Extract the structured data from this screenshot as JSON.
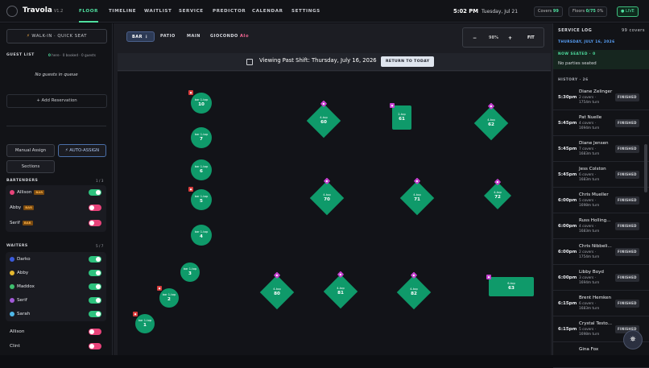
{
  "app": {
    "name": "Travola",
    "version": "V1.2"
  },
  "nav": [
    "FLOOR",
    "TIMELINE",
    "WAITLIST",
    "SERVICE",
    "PREDICTOR",
    "CALENDAR",
    "SETTINGS"
  ],
  "header": {
    "time": "5:02 PM",
    "date": "Tuesday, Jul 21",
    "covers_label": "Covers",
    "covers_value": "99",
    "floors_label": "Floors",
    "floors_value": "0/75",
    "floors_pct": "0%",
    "live": "LIVE"
  },
  "left": {
    "walkin": "WALK-IN · QUICK SEAT",
    "guest_list": "GUEST LIST",
    "here": "0",
    "here_l": "here",
    "booked": "0",
    "booked_l": "booked",
    "guests": "0",
    "guests_l": "guests",
    "empty": "No guests in queue",
    "add": "+ Add Reservation",
    "manual": "Manual Assign",
    "auto": "AUTO-ASSIGN",
    "sections": "Sections",
    "bartenders_h": "BARTENDERS",
    "bartenders_c": "1 / 3",
    "bartenders": [
      {
        "name": "Allison",
        "tag": "BAR",
        "color": "#e8437a",
        "on": true
      },
      {
        "name": "Abby",
        "tag": "BAR",
        "color": "",
        "on": false
      },
      {
        "name": "Serif",
        "tag": "BAR",
        "color": "",
        "on": false
      }
    ],
    "waiters_h": "WAITERS",
    "waiters_c": "5 / 7",
    "waiters": [
      {
        "name": "Darko",
        "color": "#3b5bdb",
        "on": true
      },
      {
        "name": "Abby",
        "color": "#e5b82f",
        "on": true
      },
      {
        "name": "Maddox",
        "color": "#3fbf6f",
        "on": true
      },
      {
        "name": "Serif",
        "color": "#a35ad8",
        "on": true
      },
      {
        "name": "Sarah",
        "color": "#4fb8e8",
        "on": true
      }
    ],
    "others": [
      {
        "name": "Allison",
        "on": false
      },
      {
        "name": "Clint",
        "on": false
      }
    ]
  },
  "main": {
    "filters": [
      "BAR",
      "PATIO",
      "MAIN",
      "GIOCONDO",
      "AI"
    ],
    "zoom": {
      "minus": "−",
      "value": "98%",
      "plus": "+",
      "fit": "FIT"
    },
    "banner": "Viewing Past Shift: Thursday, July 16, 2026",
    "return": "RETURN TO TODAY"
  },
  "tables": [
    {
      "num": "10",
      "label": "bar 1-top",
      "shape": "round",
      "badge": "r"
    },
    {
      "num": "7",
      "label": "bar 1-top",
      "shape": "round",
      "badge": ""
    },
    {
      "num": "6",
      "label": "bar 1-top",
      "shape": "round",
      "badge": ""
    },
    {
      "num": "5",
      "label": "bar 1-top",
      "shape": "round",
      "badge": "r"
    },
    {
      "num": "4",
      "label": "bar 1-top",
      "shape": "round",
      "badge": ""
    },
    {
      "num": "3",
      "label": "bar 1-top",
      "shape": "round",
      "badge": ""
    },
    {
      "num": "2",
      "label": "bar 1-top",
      "shape": "round",
      "badge": "r"
    },
    {
      "num": "1",
      "label": "bar 1-top",
      "shape": "round",
      "badge": "r"
    },
    {
      "num": "60",
      "label": "4-top",
      "shape": "diamond",
      "badge": "p"
    },
    {
      "num": "61",
      "label": "2-top",
      "shape": "rect",
      "badge": "p"
    },
    {
      "num": "62",
      "label": "4-top",
      "shape": "diamond",
      "badge": "p"
    },
    {
      "num": "70",
      "label": "4-top",
      "shape": "diamond",
      "badge": "p"
    },
    {
      "num": "71",
      "label": "4-top",
      "shape": "diamond",
      "badge": "p"
    },
    {
      "num": "72",
      "label": "4-top",
      "shape": "diamond",
      "badge": "p"
    },
    {
      "num": "80",
      "label": "4-top",
      "shape": "diamond",
      "badge": "p"
    },
    {
      "num": "81",
      "label": "4-top",
      "shape": "diamond",
      "badge": "p"
    },
    {
      "num": "82",
      "label": "4-top",
      "shape": "diamond",
      "badge": "p"
    },
    {
      "num": "63",
      "label": "6-top",
      "shape": "rect",
      "badge": "p"
    }
  ],
  "log": {
    "title": "SERVICE LOG",
    "covers": "99 covers",
    "date": "THURSDAY, JULY 16, 2026",
    "now_seated": "NOW SEATED · 0",
    "none": "No parties seated",
    "history": "HISTORY · 26",
    "items": [
      {
        "time": "5:30pm",
        "name": "Diane Zelinger",
        "covers": "2 covers ·",
        "turn": "1754m turn",
        "status": "FINISHED"
      },
      {
        "time": "5:45pm",
        "name": "Pat Nuelle",
        "covers": "4 covers ·",
        "turn": "1694m turn",
        "status": "FINISHED"
      },
      {
        "time": "5:45pm",
        "name": "Diane Jensen",
        "covers": "7 covers ·",
        "turn": "1683m turn",
        "status": "FINISHED"
      },
      {
        "time": "5:45pm",
        "name": "Jess Colston",
        "covers": "6 covers ·",
        "turn": "1683m turn",
        "status": "FINISHED"
      },
      {
        "time": "6:00pm",
        "name": "Chris Mueller",
        "covers": "5 covers ·",
        "turn": "1698m turn",
        "status": "FINISHED"
      },
      {
        "time": "6:00pm",
        "name": "Russ Holling...",
        "covers": "4 covers ·",
        "turn": "1683m turn",
        "status": "FINISHED"
      },
      {
        "time": "6:00pm",
        "name": "Chris Nibbeli...",
        "covers": "2 covers ·",
        "turn": "1754m turn",
        "status": "FINISHED"
      },
      {
        "time": "6:00pm",
        "name": "Libby Boyd",
        "covers": "3 covers ·",
        "turn": "1694m turn",
        "status": "FINISHED"
      },
      {
        "time": "6:15pm",
        "name": "Brent Hemken",
        "covers": "6 covers ·",
        "turn": "1683m turn",
        "status": "FINISHED"
      },
      {
        "time": "6:15pm",
        "name": "Crystal Testo...",
        "covers": "5 covers ·",
        "turn": "1698m turn",
        "status": "FINISHED"
      },
      {
        "time": "",
        "name": "Gina Fox",
        "covers": "",
        "turn": "",
        "status": ""
      }
    ]
  }
}
